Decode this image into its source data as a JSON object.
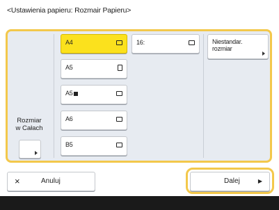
{
  "title": "<Ustawienia papieru: Rozmair Papieru>",
  "sizes": [
    {
      "label": "A4",
      "icon": "landscape-paper-icon",
      "selected": true
    },
    {
      "label": "A5",
      "icon": "portrait-paper-icon"
    },
    {
      "label": "A5",
      "icon": "landscape-paper-icon",
      "marker": true
    },
    {
      "label": "A6",
      "icon": "landscape-paper-icon"
    },
    {
      "label": "B5",
      "icon": "landscape-paper-icon"
    },
    {
      "label": "16:",
      "icon": "landscape-paper-icon"
    }
  ],
  "custom_size": {
    "line1": "Niestandar.",
    "line2": "rozmiar"
  },
  "auto_size": {
    "line1": "Rozmiar",
    "line2": "w Całach"
  },
  "cancel": {
    "icon": "close-icon",
    "symbol": "×",
    "label": "Anuluj"
  },
  "next": {
    "label": "Dalej",
    "icon": "play-arrow-icon",
    "symbol": "▶"
  },
  "colors": {
    "highlight": "#f3c84b",
    "selected": "#fbe11d",
    "panel": "#e7ebf1"
  }
}
